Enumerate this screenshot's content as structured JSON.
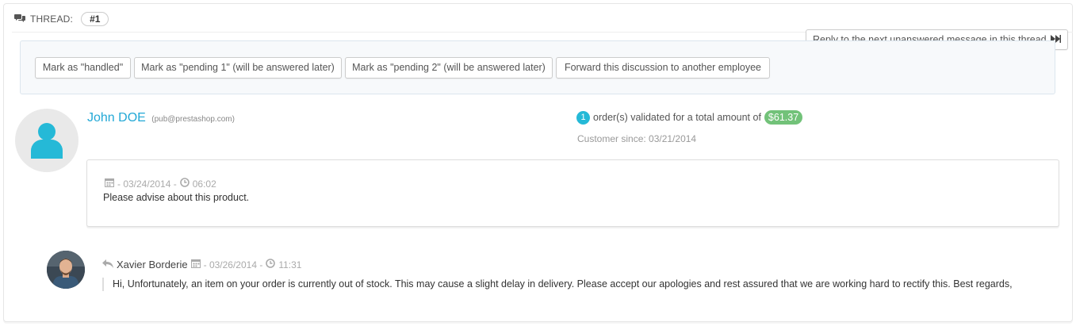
{
  "thread": {
    "label": "THREAD:",
    "number": "#1"
  },
  "reply_next": {
    "label": "Reply to the next unanswered message in this thread"
  },
  "actions": [
    {
      "label": "Mark as \"handled\""
    },
    {
      "label": "Mark as \"pending 1\" (will be answered later)"
    },
    {
      "label": "Mark as \"pending 2\" (will be answered later)"
    },
    {
      "label": "Forward this discussion to another employee"
    }
  ],
  "customer": {
    "name": "John DOE",
    "email": "(pub@prestashop.com)",
    "orders_count": "1",
    "orders_text": "order(s) validated for a total amount of",
    "orders_total": "$61.37",
    "since": "Customer since: 03/21/2014"
  },
  "message": {
    "date": "- 03/24/2014 -",
    "time": "06:02",
    "text": "Please advise about this product."
  },
  "reply": {
    "author": "Xavier Borderie",
    "date": "- 03/26/2014 -",
    "time": "11:31",
    "text": "Hi, Unfortunately, an item on your order is currently out of stock. This may cause a slight delay in delivery. Please accept our apologies and rest assured that we are working hard to rectify this. Best regards,"
  },
  "colors": {
    "accent": "#25b9d7",
    "amount_badge": "#72c279",
    "customer_name": "#22a8d6"
  },
  "icons": {
    "thread": "comments-icon",
    "reply_next": "forward-icon",
    "customer_avatar": "user-icon",
    "calendar": "calendar-icon",
    "clock": "clock-icon",
    "reply": "reply-arrow-icon"
  }
}
